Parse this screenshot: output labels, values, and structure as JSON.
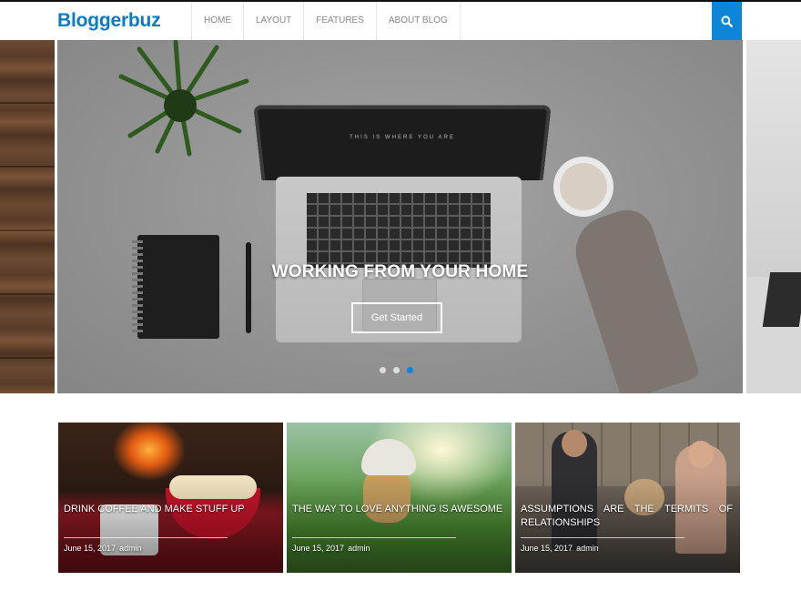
{
  "header": {
    "logo": "Bloggerbuz",
    "nav": [
      {
        "label": "HOME"
      },
      {
        "label": "LAYOUT"
      },
      {
        "label": "FEATURES"
      },
      {
        "label": "ABOUT BLOG"
      }
    ],
    "search_icon": "search-icon",
    "accent_color": "#0d85d8"
  },
  "slider": {
    "title": "WORKING FROM YOUR HOME",
    "cta_label": "Get Started",
    "screen_text": "THIS IS WHERE YOU ARE",
    "dots": 3,
    "active_dot": 3
  },
  "cards": [
    {
      "title": "DRINK COFFEE AND MAKE STUFF UP",
      "date": "June 15, 2017",
      "author": "admin"
    },
    {
      "title": "THE WAY TO LOVE ANYTHING IS AWESOME",
      "date": "June 15, 2017",
      "author": "admin"
    },
    {
      "title": "ASSUMPTIONS ARE THE TERMITS OF RELATIONSHIPS",
      "date": "June 15, 2017",
      "author": "admin"
    }
  ]
}
